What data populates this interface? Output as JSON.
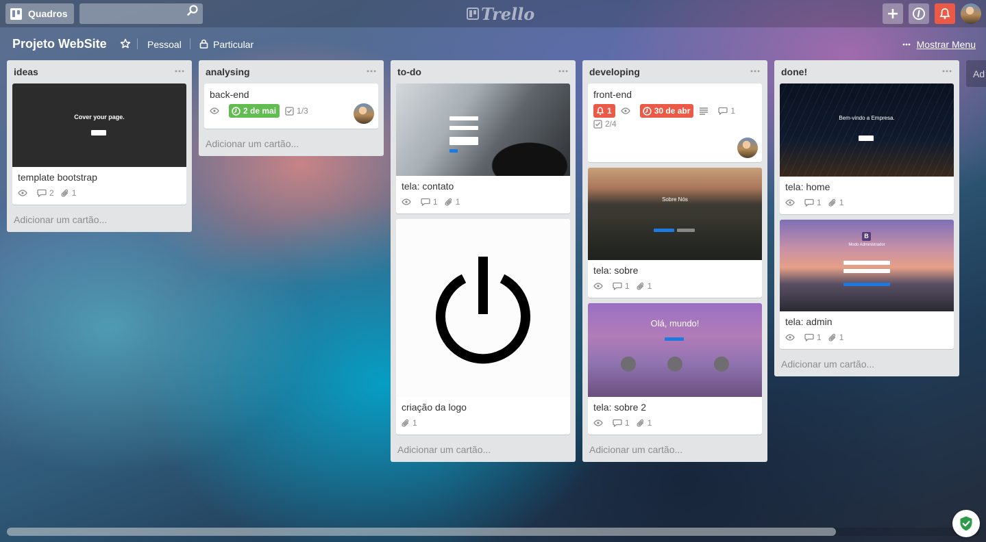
{
  "header": {
    "boards_label": "Quadros",
    "search_placeholder": "",
    "logo_text": "Trello",
    "icons": [
      "boards-icon",
      "search-icon",
      "plus-icon",
      "info-icon",
      "bell-icon",
      "avatar"
    ],
    "colors": {
      "notification": "#eb5a46",
      "plus_bg": "rgba(255,255,255,0.32)"
    }
  },
  "board": {
    "title": "Projeto WebSite",
    "team": "Pessoal",
    "visibility": "Particular",
    "menu_label": "Mostrar Menu"
  },
  "lists": [
    {
      "name": "ideas",
      "add_label": "Adicionar um cartão...",
      "cards": [
        {
          "title": "template bootstrap",
          "cover": "dark",
          "cover_text": "Cover your page.",
          "comments": "2",
          "attachments": "1"
        }
      ]
    },
    {
      "name": "analysing",
      "add_label": "Adicionar um cartão...",
      "cards": [
        {
          "title": "back-end",
          "due": "2 de mai",
          "due_color": "#61bd4f",
          "checklist": "1/3"
        }
      ]
    },
    {
      "name": "to-do",
      "add_label": "Adicionar um cartão...",
      "cards": [
        {
          "title": "tela: contato",
          "cover": "coffee",
          "comments": "1",
          "attachments": "1"
        },
        {
          "title": "criação da logo",
          "cover": "power-logo",
          "attachments": "1"
        }
      ]
    },
    {
      "name": "developing",
      "add_label": "Adicionar um cartão...",
      "cards": [
        {
          "title": "front-end",
          "notifications": "1",
          "due": "30 de abr",
          "due_color": "#eb5a46",
          "comments": "1",
          "checklist": "2/4"
        },
        {
          "title": "tela: sobre",
          "cover": "forest",
          "cover_text": "Sobre Nós",
          "comments": "1",
          "attachments": "1"
        },
        {
          "title": "tela: sobre 2",
          "cover": "purple",
          "cover_text": "Olá, mundo!",
          "comments": "1",
          "attachments": "1"
        }
      ]
    },
    {
      "name": "done!",
      "add_label": "Adicionar um cartão...",
      "cards": [
        {
          "title": "tela: home",
          "cover": "stars",
          "cover_text": "Bem-vindo a Empresa.",
          "comments": "1",
          "attachments": "1"
        },
        {
          "title": "tela: admin",
          "cover": "sunset",
          "cover_text": "Modo Administrador",
          "comments": "1",
          "attachments": "1"
        }
      ]
    }
  ],
  "add_list_partial": "Ad"
}
